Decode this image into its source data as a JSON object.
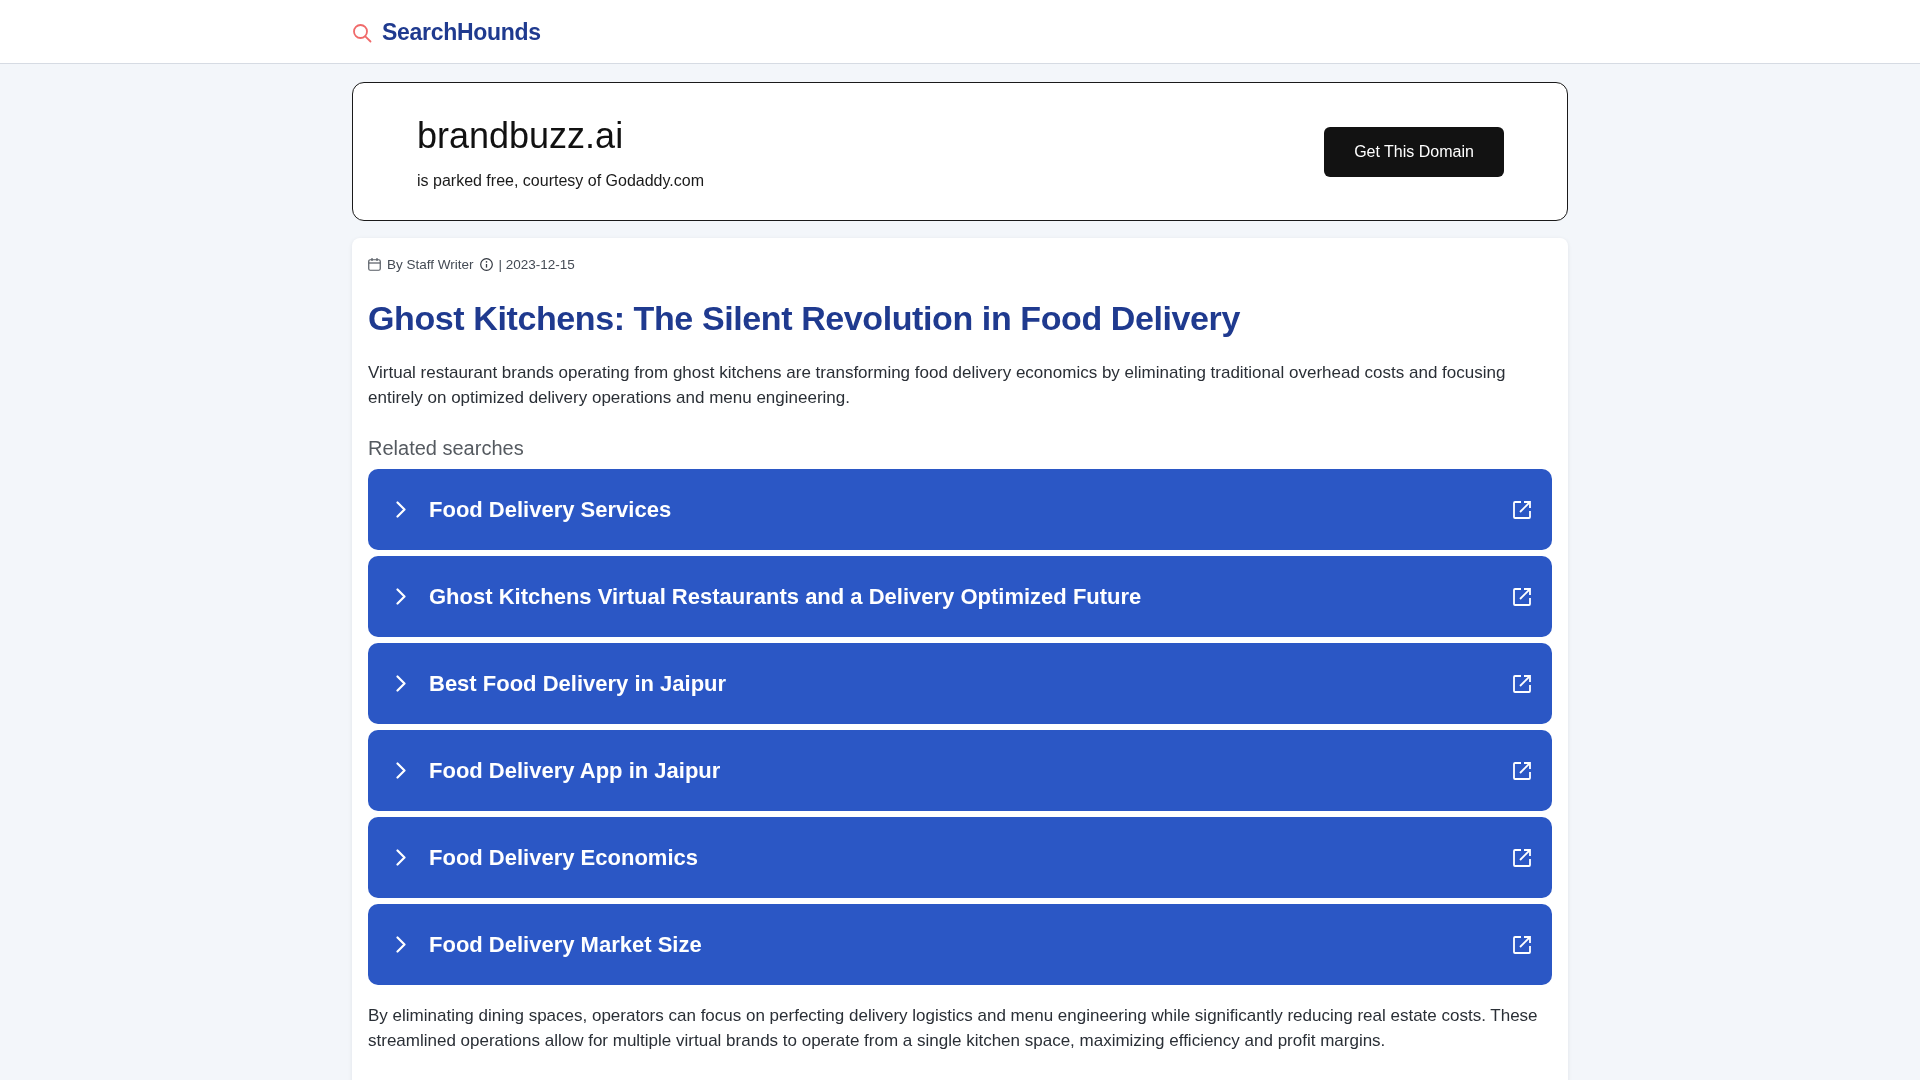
{
  "header": {
    "logo_text": "SearchHounds"
  },
  "domain_banner": {
    "domain": "brandbuzz.ai",
    "note": "is parked free, courtesy of Godaddy.com",
    "button": "Get This Domain"
  },
  "article": {
    "author": "By Staff Writer",
    "date": "| 2023-12-15",
    "title": "Ghost Kitchens: The Silent Revolution in Food Delivery",
    "intro": "Virtual restaurant brands operating from ghost kitchens are transforming food delivery economics by eliminating traditional overhead costs and focusing entirely on optimized delivery operations and menu engineering.",
    "related_heading": "Related searches",
    "related_searches": [
      {
        "label": "Food Delivery Services"
      },
      {
        "label": "Ghost Kitchens Virtual Restaurants and a Delivery Optimized Future"
      },
      {
        "label": "Best Food Delivery in Jaipur"
      },
      {
        "label": "Food Delivery App in Jaipur"
      },
      {
        "label": "Food Delivery Economics"
      },
      {
        "label": "Food Delivery Market Size"
      }
    ],
    "body": "By eliminating dining spaces, operators can focus on perfecting delivery logistics and menu engineering while significantly reducing real estate costs. These streamlined operations allow for multiple virtual brands to operate from a single kitchen space, maximizing efficiency and profit margins."
  }
}
